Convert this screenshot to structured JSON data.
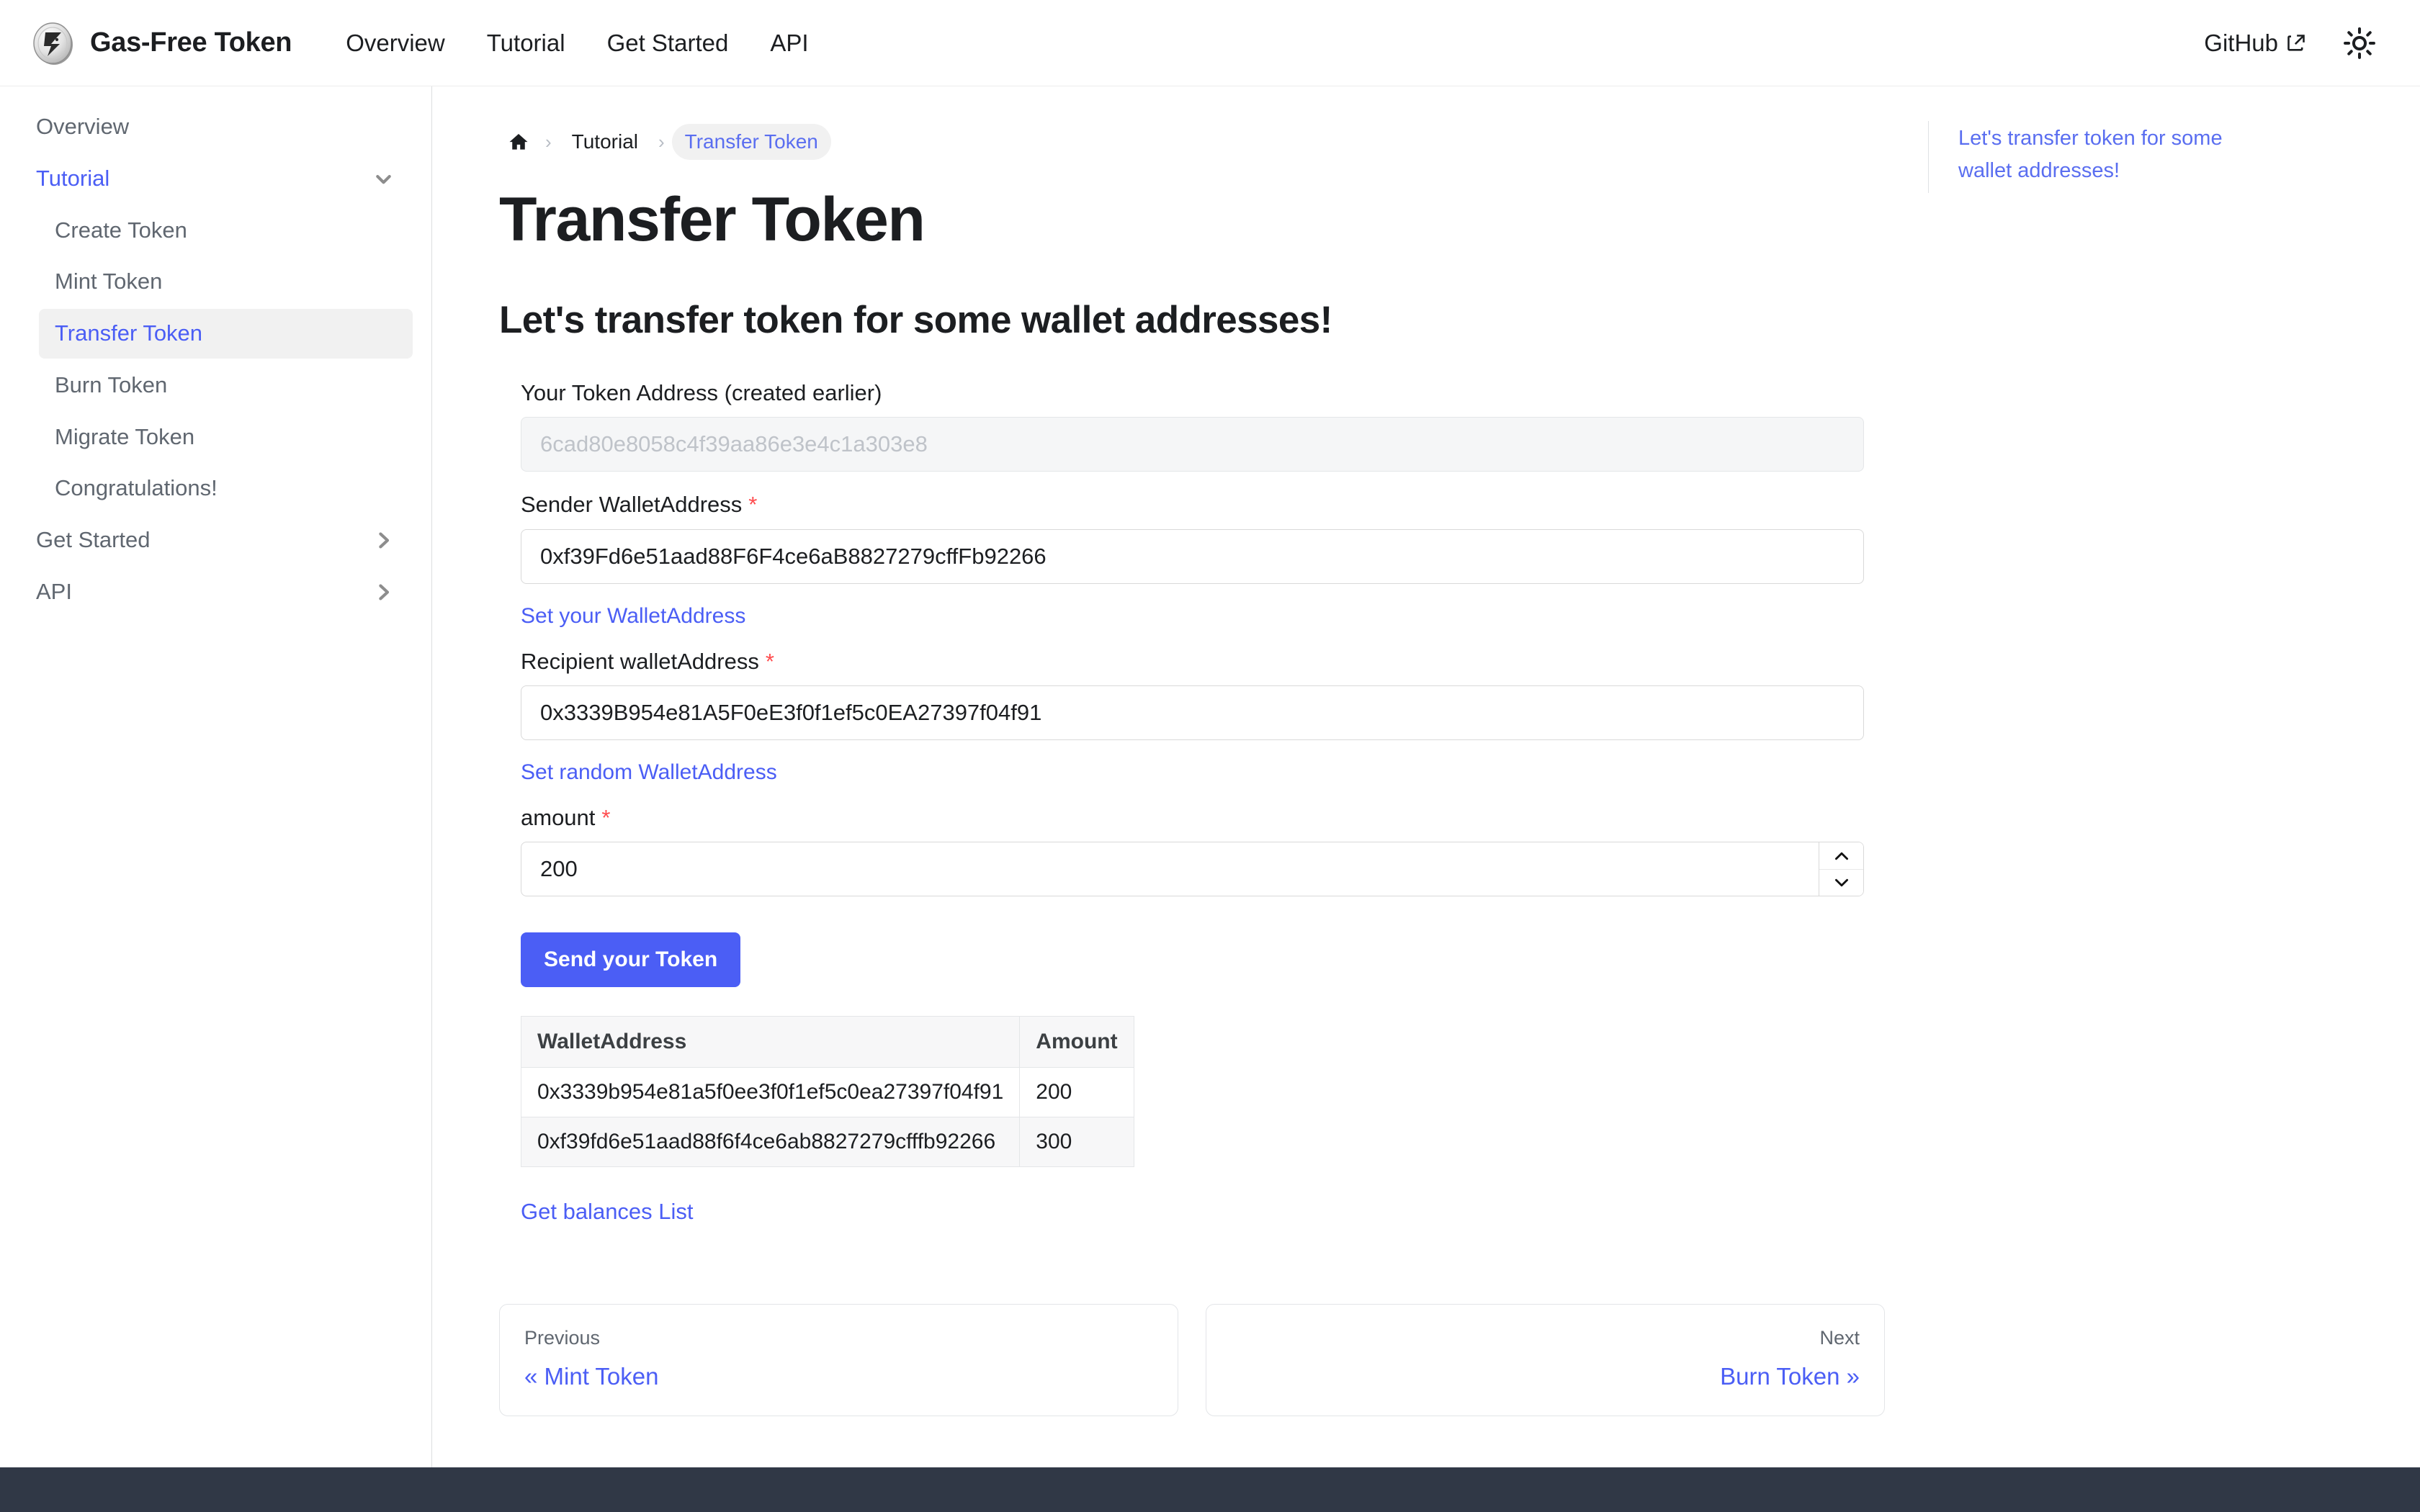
{
  "navbar": {
    "brand": "Gas-Free Token",
    "logo_icon": "gas-free-token-coin-logo",
    "links": [
      "Overview",
      "Tutorial",
      "Get Started",
      "API"
    ],
    "github_label": "GitHub",
    "github_icon": "external-link-icon",
    "theme_icon": "sun-icon"
  },
  "sidebar": {
    "items": [
      {
        "label": "Overview",
        "level": 0,
        "state": "normal",
        "icon": ""
      },
      {
        "label": "Tutorial",
        "level": 0,
        "state": "active-parent",
        "icon": "chevron-down-icon"
      },
      {
        "label": "Create Token",
        "level": 1,
        "state": "normal",
        "icon": ""
      },
      {
        "label": "Mint Token",
        "level": 1,
        "state": "normal",
        "icon": ""
      },
      {
        "label": "Transfer Token",
        "level": 1,
        "state": "selected",
        "icon": ""
      },
      {
        "label": "Burn Token",
        "level": 1,
        "state": "normal",
        "icon": ""
      },
      {
        "label": "Migrate Token",
        "level": 1,
        "state": "normal",
        "icon": ""
      },
      {
        "label": "Congratulations!",
        "level": 1,
        "state": "normal",
        "icon": ""
      },
      {
        "label": "Get Started",
        "level": 0,
        "state": "normal",
        "icon": "chevron-right-icon"
      },
      {
        "label": "API",
        "level": 0,
        "state": "normal",
        "icon": "chevron-right-icon"
      }
    ]
  },
  "breadcrumbs": {
    "home_icon": "home-icon",
    "separator": "›",
    "items": [
      "Tutorial",
      "Transfer Token"
    ]
  },
  "main": {
    "page_title": "Transfer Token",
    "section_title": "Let's transfer token for some wallet addresses!"
  },
  "form": {
    "token_address": {
      "label": "Your Token Address (created earlier)",
      "placeholder": "6cad80e8058c4f39aa86e3e4c1a303e8",
      "value": ""
    },
    "sender": {
      "label": "Sender WalletAddress",
      "required_marker": "*",
      "value": "0xf39Fd6e51aad88F6F4ce6aB8827279cffFb92266",
      "helper": "Set your WalletAddress"
    },
    "recipient": {
      "label": "Recipient walletAddress",
      "required_marker": "*",
      "value": "0x3339B954e81A5F0eE3f0f1ef5c0EA27397f04f91",
      "helper": "Set random WalletAddress"
    },
    "amount": {
      "label": "amount",
      "required_marker": "*",
      "value": "200",
      "increment_icon": "chevron-up-icon",
      "decrement_icon": "chevron-down-icon"
    },
    "submit_label": "Send your Token"
  },
  "balances": {
    "columns": [
      "WalletAddress",
      "Amount"
    ],
    "rows": [
      [
        "0x3339b954e81a5f0ee3f0f1ef5c0ea27397f04f91",
        "200"
      ],
      [
        "0xf39fd6e51aad88f6f4ce6ab8827279cfffb92266",
        "300"
      ]
    ],
    "link_label": "Get balances List"
  },
  "pager": {
    "previous_label": "Previous",
    "previous_title": "« Mint Token",
    "next_label": "Next",
    "next_title": "Burn Token »"
  },
  "toc": {
    "items": [
      "Let's transfer token for some wallet addresses!"
    ]
  },
  "colors": {
    "accent": "#4b5ef5",
    "text": "#1c1e21",
    "muted": "#606770",
    "required": "#ff4d4f",
    "footer": "#303846",
    "selected_bg": "#f1f1f1"
  }
}
